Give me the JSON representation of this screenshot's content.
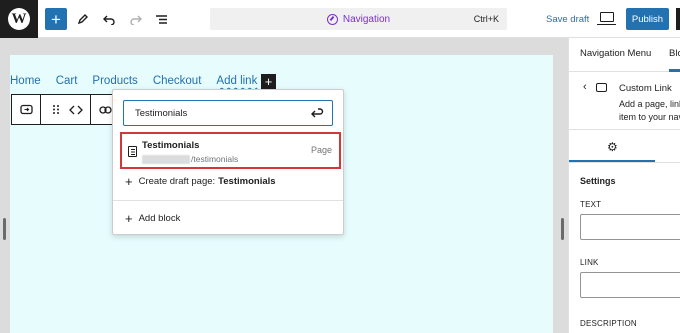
{
  "topbar": {
    "logo_letter": "W",
    "add_symbol": "+",
    "command_bar_label": "Navigation",
    "command_bar_shortcut": "Ctrl+K",
    "save_draft_label": "Save draft",
    "publish_label": "Publish"
  },
  "navigation": {
    "links": [
      "Home",
      "Cart",
      "Products",
      "Checkout",
      "Add link"
    ],
    "add_symbol": "+"
  },
  "link_popover": {
    "search_value": "Testimonials",
    "result": {
      "title": "Testimonials",
      "url_suffix": "/testimonials",
      "type": "Page"
    },
    "create_draft_prefix": "Create draft page:",
    "create_draft_name": "Testimonials",
    "add_block_label": "Add block",
    "plus_symbol": "+"
  },
  "sidebar": {
    "tabs": [
      "Navigation Menu",
      "Blo"
    ],
    "block_title": "Custom Link",
    "block_description_lines": [
      "Add a page, link",
      "item to your nav"
    ],
    "settings_heading": "Settings",
    "fields": [
      "TEXT",
      "LINK",
      "DESCRIPTION"
    ]
  },
  "colors": {
    "accent": "#2271b1",
    "command_bar_text": "#7a2fd1",
    "highlight_border": "#d63638",
    "canvas_background": "#e6fcfd"
  }
}
